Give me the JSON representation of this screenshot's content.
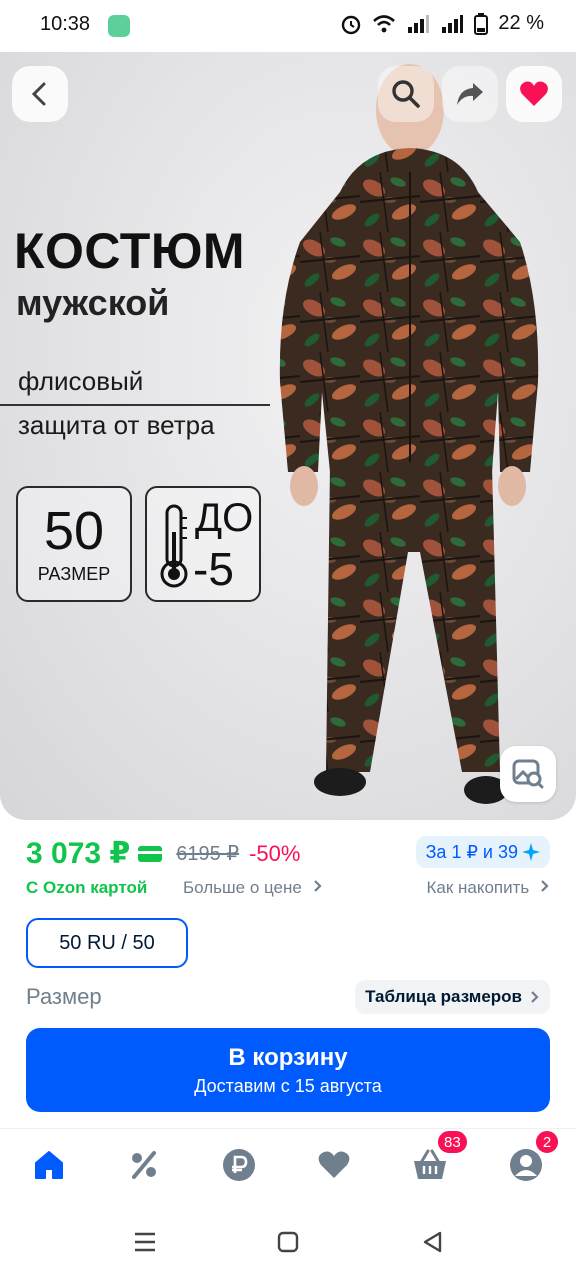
{
  "status_bar": {
    "time": "10:38",
    "battery": "22 %"
  },
  "hero": {
    "title_line1": "КОСТЮМ",
    "title_line2": "мужской",
    "feature_1": "флисовый",
    "feature_2": "защита от ветра",
    "badge_size_number": "50",
    "badge_size_label": "РАЗМЕР",
    "badge_temp_top": "ДО",
    "badge_temp_bottom": "-5"
  },
  "price": {
    "current": "3 073 ₽",
    "old": "6195 ₽",
    "discount": "-50%",
    "points": "За 1 ₽ и 39",
    "ozon_card": "С Ozon картой",
    "more_price": "Больше о цене",
    "how_collect": "Как накопить"
  },
  "size": {
    "selected": "50 RU / 50",
    "label": "Размер",
    "table_link": "Таблица размеров"
  },
  "cart": {
    "title": "В корзину",
    "subtitle": "Доставим с 15 августа"
  },
  "bottom_nav": {
    "cart_badge": "83",
    "profile_badge": "2"
  },
  "colors": {
    "accent": "#005bff",
    "green": "#10c44c",
    "pink": "#f91155"
  }
}
